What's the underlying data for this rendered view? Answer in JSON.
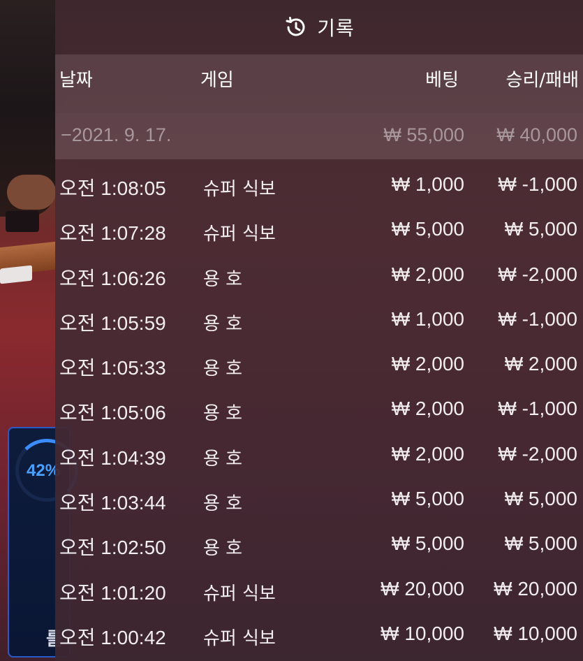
{
  "panel": {
    "title": "기록",
    "icon": "history-icon"
  },
  "columns": {
    "date": "날짜",
    "game": "게임",
    "bet": "베팅",
    "win_loss": "승리/패배"
  },
  "date_group": {
    "label": "−2021. 9. 17.",
    "bet_total": "₩ 55,000",
    "win_total": "₩ 40,000"
  },
  "rows": [
    {
      "time": "오전 1:08:05",
      "game": "슈퍼 식보",
      "bet": "₩ 1,000",
      "result": "₩ -1,000"
    },
    {
      "time": "오전 1:07:28",
      "game": "슈퍼 식보",
      "bet": "₩ 5,000",
      "result": "₩ 5,000"
    },
    {
      "time": "오전 1:06:26",
      "game": "용 호",
      "bet": "₩ 2,000",
      "result": "₩ -2,000"
    },
    {
      "time": "오전 1:05:59",
      "game": "용 호",
      "bet": "₩ 1,000",
      "result": "₩ -1,000"
    },
    {
      "time": "오전 1:05:33",
      "game": "용 호",
      "bet": "₩ 2,000",
      "result": "₩ 2,000"
    },
    {
      "time": "오전 1:05:06",
      "game": "용 호",
      "bet": "₩ 2,000",
      "result": "₩ -1,000"
    },
    {
      "time": "오전 1:04:39",
      "game": "용 호",
      "bet": "₩ 2,000",
      "result": "₩ -2,000"
    },
    {
      "time": "오전 1:03:44",
      "game": "용 호",
      "bet": "₩ 5,000",
      "result": "₩ 5,000"
    },
    {
      "time": "오전 1:02:50",
      "game": "용 호",
      "bet": "₩ 5,000",
      "result": "₩ 5,000"
    },
    {
      "time": "오전 1:01:20",
      "game": "슈퍼 식보",
      "bet": "₩ 20,000",
      "result": "₩ 20,000"
    },
    {
      "time": "오전 1:00:42",
      "game": "슈퍼 식보",
      "bet": "₩ 10,000",
      "result": "₩ 10,000"
    }
  ],
  "stats_widget": {
    "percent": "42%",
    "progress": 0.42,
    "partial_glyph": "를"
  }
}
